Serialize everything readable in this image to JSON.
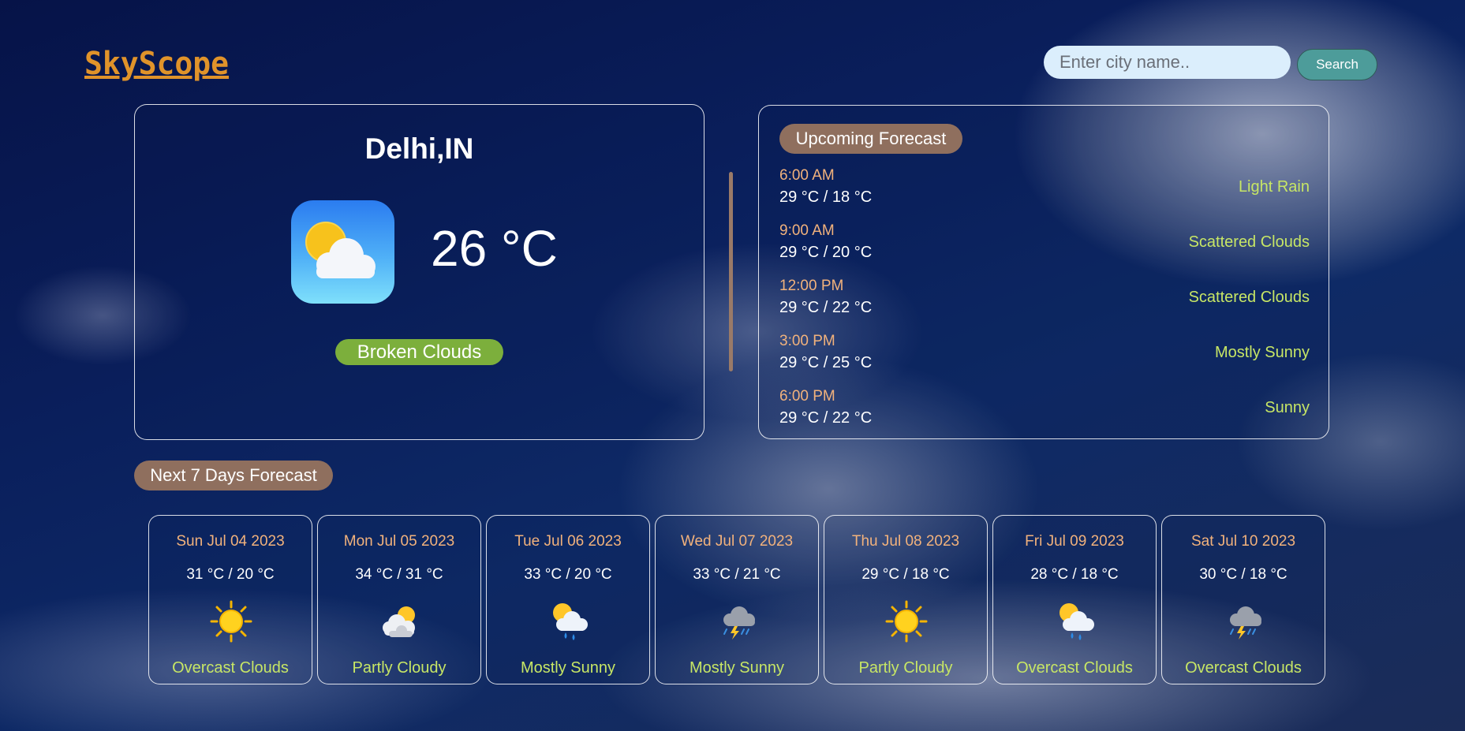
{
  "app": {
    "logo": "SkyScope"
  },
  "search": {
    "placeholder": "Enter city name..",
    "button_label": "Search"
  },
  "current": {
    "city": "Delhi,IN",
    "temperature": "26 °C",
    "condition": "Broken Clouds",
    "icon": "partly-cloudy-app-icon"
  },
  "upcoming": {
    "title": "Upcoming Forecast",
    "items": [
      {
        "time": "6:00 AM",
        "range": "29 °C / 18 °C",
        "condition": "Light Rain"
      },
      {
        "time": "9:00 AM",
        "range": "29 °C / 20 °C",
        "condition": "Scattered Clouds"
      },
      {
        "time": "12:00 PM",
        "range": "29 °C / 22 °C",
        "condition": "Scattered Clouds"
      },
      {
        "time": "3:00 PM",
        "range": "29 °C / 25 °C",
        "condition": "Mostly Sunny"
      },
      {
        "time": "6:00 PM",
        "range": "29 °C / 22 °C",
        "condition": "Sunny"
      }
    ]
  },
  "week": {
    "title": "Next 7 Days Forecast",
    "days": [
      {
        "date": "Sun Jul 04 2023",
        "range": "31 °C / 20 °C",
        "icon": "sun-icon",
        "condition": "Overcast Clouds"
      },
      {
        "date": "Mon Jul 05 2023",
        "range": "34 °C / 31 °C",
        "icon": "sun-cloud-icon",
        "condition": "Partly Cloudy"
      },
      {
        "date": "Tue Jul 06 2023",
        "range": "33 °C / 20 °C",
        "icon": "sun-rain-icon",
        "condition": "Mostly Sunny"
      },
      {
        "date": "Wed Jul 07 2023",
        "range": "33 °C / 21 °C",
        "icon": "thunderstorm-icon",
        "condition": "Mostly Sunny"
      },
      {
        "date": "Thu Jul 08 2023",
        "range": "29 °C / 18 °C",
        "icon": "sun-icon",
        "condition": "Partly Cloudy"
      },
      {
        "date": "Fri Jul 09 2023",
        "range": "28 °C / 18 °C",
        "icon": "sun-rain-icon",
        "condition": "Overcast Clouds"
      },
      {
        "date": "Sat Jul 10 2023",
        "range": "30 °C / 18 °C",
        "icon": "thunderstorm-icon",
        "condition": "Overcast Clouds"
      }
    ]
  },
  "colors": {
    "logo": "#e0932a",
    "accent_green": "#7caf3c",
    "condition_text": "#c7e665",
    "time_text": "#f2b27c",
    "badge_brown": "#8f6f5e",
    "search_button": "#4d9c9a"
  }
}
